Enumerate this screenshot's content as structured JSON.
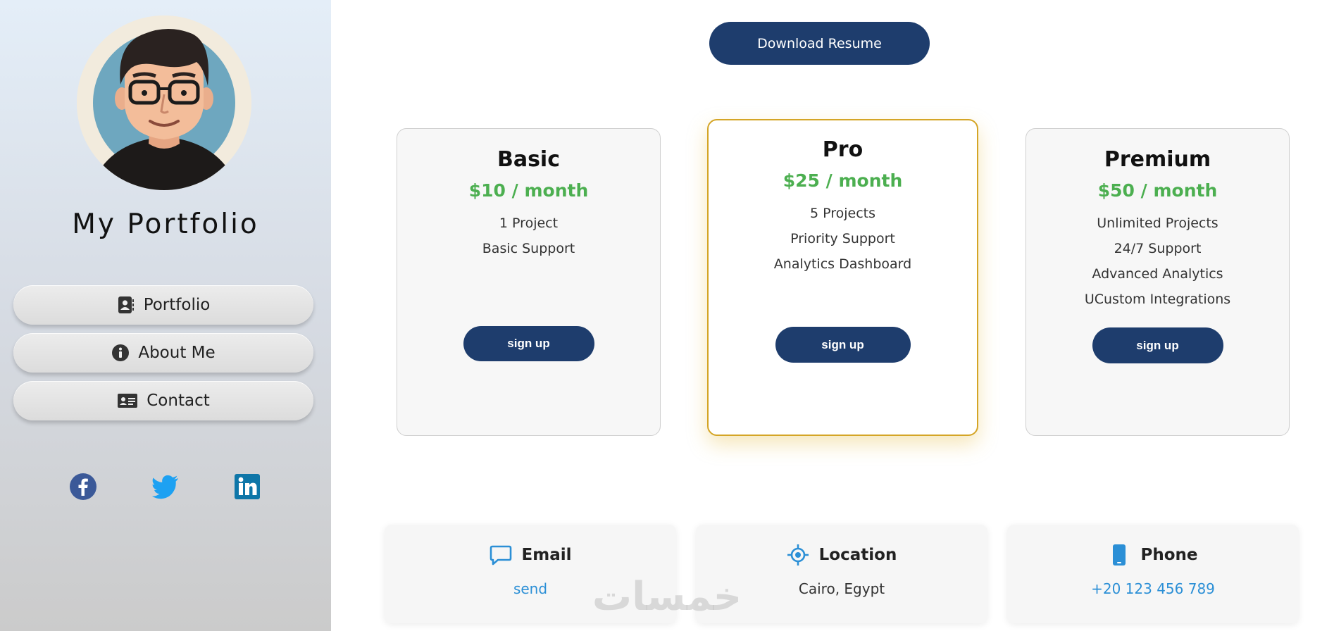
{
  "sidebar": {
    "title": "My Portfolio",
    "nav": [
      {
        "label": "Portfolio",
        "icon": "address-book-icon"
      },
      {
        "label": "About Me",
        "icon": "info-circle-icon"
      },
      {
        "label": "Contact",
        "icon": "id-card-icon"
      }
    ],
    "social": [
      {
        "icon": "facebook-icon",
        "color": "#3b5998"
      },
      {
        "icon": "twitter-icon",
        "color": "#1da1f2"
      },
      {
        "icon": "linkedin-icon",
        "color": "#0e76a8"
      }
    ]
  },
  "main": {
    "download_label": "Download Resume",
    "plans": [
      {
        "name": "Basic",
        "price": "$10 / month",
        "features": [
          "1 Project",
          "Basic Support"
        ],
        "cta": "sign up"
      },
      {
        "name": "Pro",
        "price": "$25 / month",
        "features": [
          "5 Projects",
          "Priority Support",
          "Analytics Dashboard"
        ],
        "cta": "sign up",
        "featured": true
      },
      {
        "name": "Premium",
        "price": "$50 / month",
        "features": [
          "Unlimited Projects",
          "24/7 Support",
          "Advanced Analytics",
          "UCustom Integrations"
        ],
        "cta": "sign up"
      }
    ],
    "contacts": [
      {
        "label": "Email",
        "value": "send",
        "icon": "chat-bubble-icon"
      },
      {
        "label": "Location",
        "value": "Cairo, Egypt",
        "icon": "location-crosshair-icon"
      },
      {
        "label": "Phone",
        "value": "+20 123 456 789",
        "icon": "smartphone-icon"
      }
    ],
    "watermark": "خمسات"
  },
  "colors": {
    "accent_navy": "#1e3d6d",
    "price_green": "#4caf50",
    "featured_border": "#d4a526",
    "link_blue": "#2b8fd6"
  }
}
